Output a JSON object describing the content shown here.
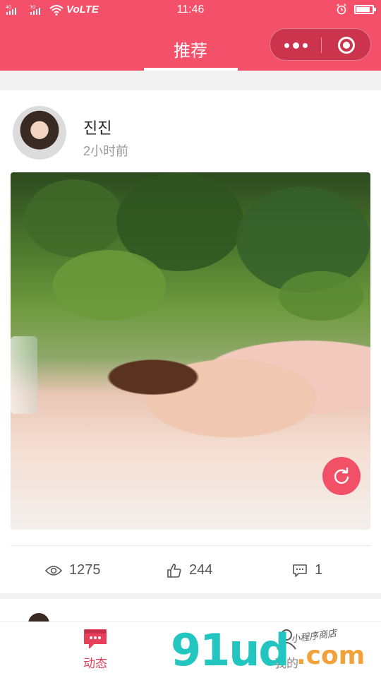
{
  "status_bar": {
    "network_left": "4G",
    "network_right": "3G",
    "volte": "VoLTE",
    "time": "11:46",
    "icons": [
      "signal-icon",
      "wifi-icon",
      "alarm-icon",
      "battery-icon"
    ]
  },
  "header": {
    "title": "推荐",
    "capsule": {
      "icons": [
        "more-dots-icon",
        "close-target-icon"
      ]
    },
    "background_color": "#f5506a"
  },
  "post": {
    "username": "진진",
    "time": "2小时前",
    "image": "photo",
    "fab_icon": "refresh-icon",
    "stats": {
      "views": "1275",
      "likes": "244",
      "comments": "1"
    }
  },
  "tabbar": {
    "tabs": [
      {
        "label": "动态",
        "icon": "chat-bubble-icon",
        "active": true
      },
      {
        "label": "我的",
        "icon": "person-icon",
        "active": false
      }
    ],
    "active_color": "#e8405a"
  },
  "watermark": {
    "main": "91ud",
    "com": ".com",
    "sub": "小程序商店"
  }
}
